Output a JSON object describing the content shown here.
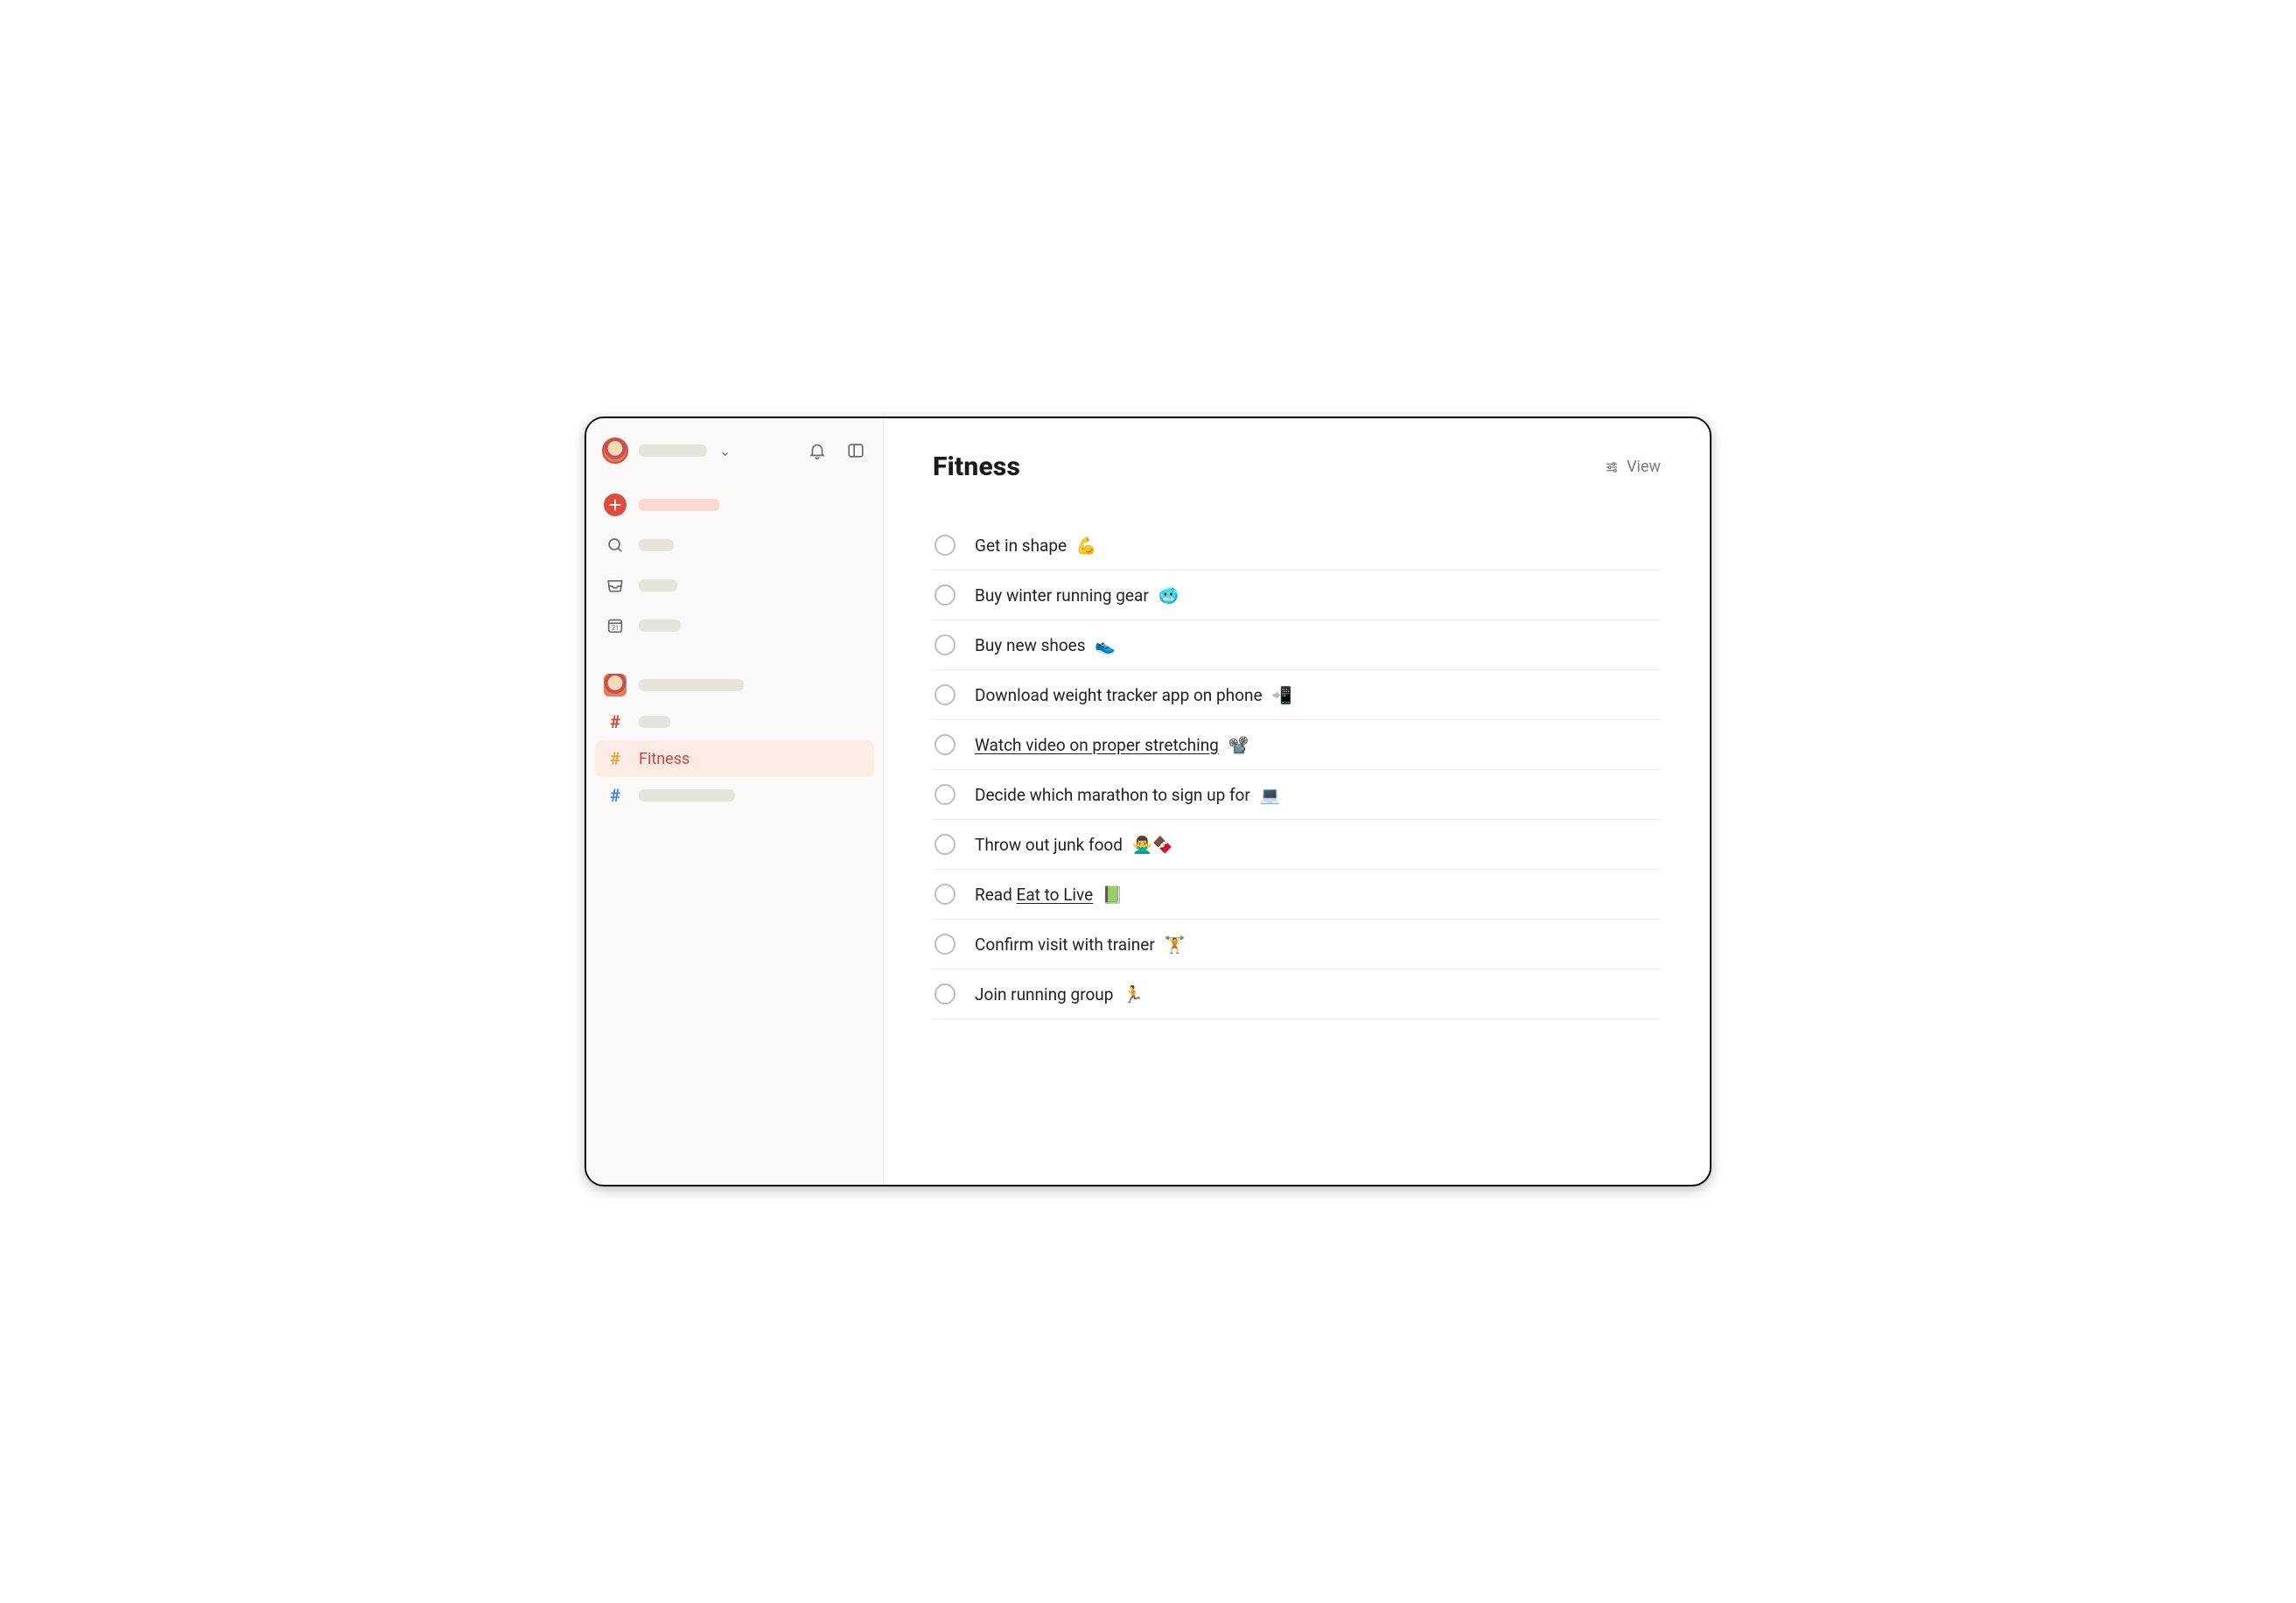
{
  "header": {
    "title": "Fitness",
    "view_label": "View"
  },
  "sidebar": {
    "projects": {
      "active_label": "Fitness"
    },
    "calendar_day": "21"
  },
  "tasks": [
    {
      "text": "Get in shape",
      "emoji": "💪",
      "linked": false
    },
    {
      "text": "Buy winter running gear",
      "emoji": "🥶",
      "linked": false
    },
    {
      "text": "Buy new shoes",
      "emoji": "👟",
      "linked": false
    },
    {
      "text": "Download weight tracker app on phone",
      "emoji": "📲",
      "linked": false
    },
    {
      "text": "Watch video on proper stretching",
      "emoji": "📽️",
      "linked": true
    },
    {
      "text": "Decide which marathon to sign up for",
      "emoji": "💻",
      "linked": false
    },
    {
      "text": "Throw out junk food",
      "emoji": "🙅‍♂️🍫",
      "linked": false
    },
    {
      "text_prefix": "Read ",
      "text": "Eat to Live",
      "emoji": "📗",
      "linked": true
    },
    {
      "text": "Confirm visit with trainer",
      "emoji": "🏋️",
      "linked": false
    },
    {
      "text": "Join running group",
      "emoji": "🏃",
      "linked": false
    }
  ]
}
